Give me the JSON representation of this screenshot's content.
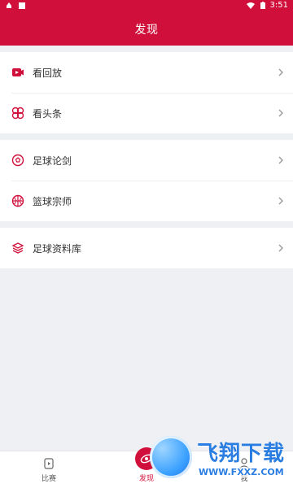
{
  "status_bar": {
    "time": "3:51"
  },
  "header": {
    "title": "发现"
  },
  "menu": {
    "groups": [
      {
        "items": [
          {
            "label": "看回放",
            "icon": "video-play-icon"
          },
          {
            "label": "看头条",
            "icon": "clover-icon"
          }
        ]
      },
      {
        "items": [
          {
            "label": "足球论剑",
            "icon": "football-icon"
          },
          {
            "label": "篮球宗师",
            "icon": "basketball-icon"
          }
        ]
      },
      {
        "items": [
          {
            "label": "足球资料库",
            "icon": "layers-icon"
          }
        ]
      }
    ]
  },
  "bottom_nav": {
    "tabs": [
      {
        "label": "比赛",
        "icon": "match-icon",
        "active": false
      },
      {
        "label": "发现",
        "icon": "discover-icon",
        "active": true
      },
      {
        "label": "我",
        "icon": "profile-icon",
        "active": false
      }
    ]
  },
  "watermark": {
    "title": "飞翔下载",
    "url": "WWW.FXXZ.COM"
  },
  "colors": {
    "brand": "#d0103a",
    "bg": "#eef0f4"
  }
}
